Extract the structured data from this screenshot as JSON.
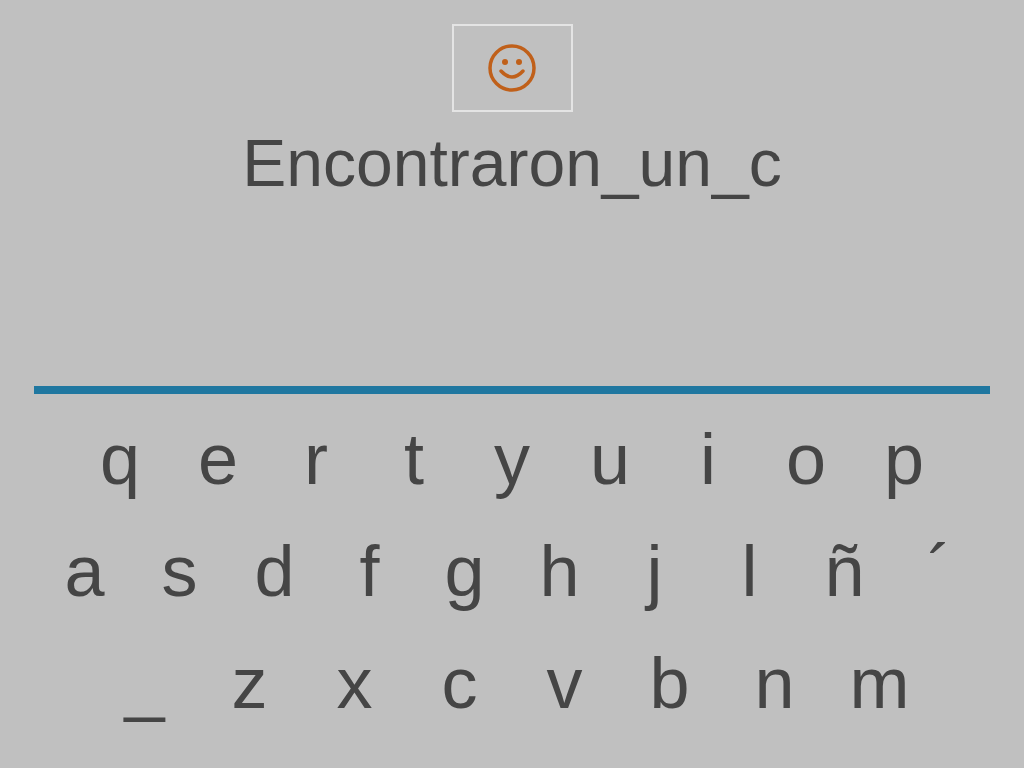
{
  "phrase": "Encontraron_un_c",
  "keyboard": {
    "rows": [
      {
        "keys": [
          "q",
          "e",
          "r",
          "t",
          "y",
          "u",
          "i",
          "o",
          "p"
        ]
      },
      {
        "keys": [
          "a",
          "s",
          "d",
          "f",
          "g",
          "h",
          "j",
          "l",
          "ñ",
          "´"
        ]
      },
      {
        "keys": [
          "_",
          "z",
          "x",
          "c",
          "v",
          "b",
          "n",
          "m"
        ]
      }
    ]
  }
}
